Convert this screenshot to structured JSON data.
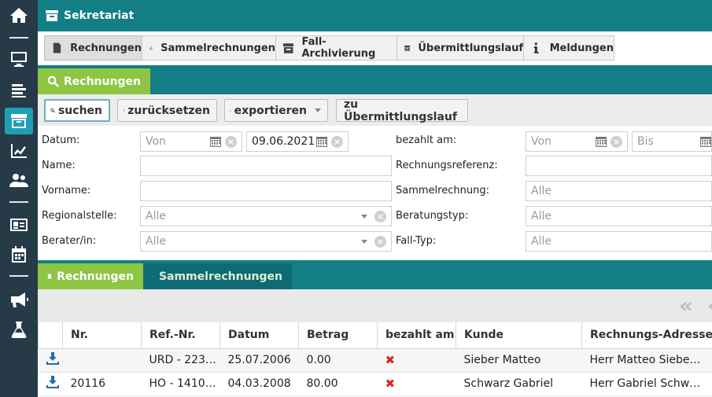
{
  "sidebar": {
    "items": [
      {
        "icon": "home-icon"
      },
      {
        "icon": "monitor-icon"
      },
      {
        "icon": "list-icon"
      },
      {
        "icon": "archive-icon"
      },
      {
        "icon": "chart-icon"
      },
      {
        "icon": "users-icon"
      },
      {
        "icon": "id-card-icon"
      },
      {
        "icon": "calendar-icon"
      },
      {
        "icon": "megaphone-icon"
      },
      {
        "icon": "flask-icon"
      }
    ],
    "active_index": 3
  },
  "header": {
    "title": "Sekretariat",
    "icon": "archive-icon"
  },
  "module_tabs": [
    {
      "label": "Rechnungen",
      "icon": "invoice-icon",
      "active": true
    },
    {
      "label": "Sammelrechnungen",
      "icon": "hand-money-icon",
      "active": false
    },
    {
      "label": "Fall-Archivierung",
      "icon": "archive-icon",
      "active": false
    },
    {
      "label": "Übermittlungslauf",
      "icon": "archive-icon",
      "active": false
    },
    {
      "label": "Meldungen",
      "icon": "info-icon",
      "active": false
    }
  ],
  "search_tab": {
    "label": "Rechnungen",
    "icon": "search-icon"
  },
  "toolbar": {
    "search_label": "suchen",
    "reset_label": "zurücksetzen",
    "export_label": "exportieren",
    "transfer_label": "zu Übermittlungslauf"
  },
  "filters": {
    "datum_label": "Datum:",
    "datum_from_placeholder": "Von",
    "datum_to_value": "09.06.2021",
    "name_label": "Name:",
    "vorname_label": "Vorname:",
    "regionalstelle_label": "Regionalstelle:",
    "regionalstelle_value": "Alle",
    "berater_label": "Berater/in:",
    "berater_value": "Alle",
    "bezahlt_label": "bezahlt am:",
    "bezahlt_from_placeholder": "Von",
    "bezahlt_to_placeholder": "Bis",
    "referenz_label": "Rechnungsreferenz:",
    "sammel_label": "Sammelrechnung:",
    "sammel_value": "Alle",
    "beratungstyp_label": "Beratungstyp:",
    "beratungstyp_value": "Alle",
    "falltyp_label": "Fall-Typ:",
    "falltyp_value": "Alle"
  },
  "result_tabs": [
    {
      "label": "Rechnungen",
      "icon": "invoice-icon",
      "active": true
    },
    {
      "label": "Sammelrechnungen",
      "icon": "hand-money-icon",
      "active": false
    }
  ],
  "pager": {
    "first_symbol": "«"
  },
  "table": {
    "columns": [
      "",
      "Nr.",
      "Ref.-Nr.",
      "Datum",
      "Betrag",
      "bezahlt am",
      "Kunde",
      "Rechnungs-Adresse"
    ],
    "rows": [
      {
        "nr": "",
        "ref": "URD - 223…",
        "datum": "25.07.2006",
        "betrag": "0.00",
        "bezahlt": "✖",
        "kunde": "Sieber Matteo",
        "adresse": "Herr Matteo Siebe…"
      },
      {
        "nr": "20116",
        "ref": "HO - 1410…",
        "datum": "04.03.2008",
        "betrag": "80.00",
        "bezahlt": "✖",
        "kunde": "Schwarz Gabriel",
        "adresse": "Herr Gabriel Schw…"
      }
    ]
  },
  "colors": {
    "sidebar": "#263a47",
    "header": "#137e86",
    "accent_green": "#8ec644",
    "active_sidebar": "#1f9fb4",
    "unpaid_mark": "#d6281f"
  }
}
